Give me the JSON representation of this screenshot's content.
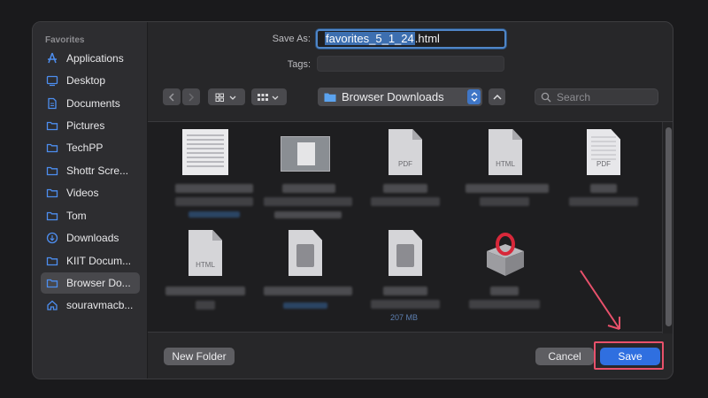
{
  "sidebar": {
    "section": "Favorites",
    "items": [
      {
        "label": "Applications",
        "icon": "applications-icon",
        "selected": false
      },
      {
        "label": "Desktop",
        "icon": "desktop-icon",
        "selected": false
      },
      {
        "label": "Documents",
        "icon": "document-icon",
        "selected": false
      },
      {
        "label": "Pictures",
        "icon": "folder-icon",
        "selected": false
      },
      {
        "label": "TechPP",
        "icon": "folder-icon",
        "selected": false
      },
      {
        "label": "Shottr Scre...",
        "icon": "folder-icon",
        "selected": false
      },
      {
        "label": "Videos",
        "icon": "folder-icon",
        "selected": false
      },
      {
        "label": "Tom",
        "icon": "folder-icon",
        "selected": false
      },
      {
        "label": "Downloads",
        "icon": "download-icon",
        "selected": false
      },
      {
        "label": "KIIT Docum...",
        "icon": "folder-icon",
        "selected": false
      },
      {
        "label": "Browser Do...",
        "icon": "folder-icon",
        "selected": true
      },
      {
        "label": "souravmacb...",
        "icon": "home-icon",
        "selected": false
      }
    ]
  },
  "save_as": {
    "label": "Save As:",
    "value_selected": "favorites_5_1_24",
    "value_ext": ".html"
  },
  "tags": {
    "label": "Tags:",
    "value": ""
  },
  "toolbar": {
    "location": "Browser Downloads",
    "search_placeholder": "Search"
  },
  "files": [
    {
      "type": "scan",
      "caption": ""
    },
    {
      "type": "screenshot",
      "caption": ""
    },
    {
      "type": "doc",
      "caption": "PDF"
    },
    {
      "type": "doc",
      "caption": "HTML"
    },
    {
      "type": "scan-pdf",
      "caption": "PDF"
    },
    {
      "type": "doc",
      "caption": "HTML"
    },
    {
      "type": "disk",
      "caption": ""
    },
    {
      "type": "disk",
      "caption": "207 MB"
    },
    {
      "type": "package",
      "caption": ""
    }
  ],
  "buttons": {
    "new_folder": "New Folder",
    "cancel": "Cancel",
    "save": "Save"
  },
  "colors": {
    "accent": "#2f6fe0",
    "annotation": "#e8516b"
  }
}
